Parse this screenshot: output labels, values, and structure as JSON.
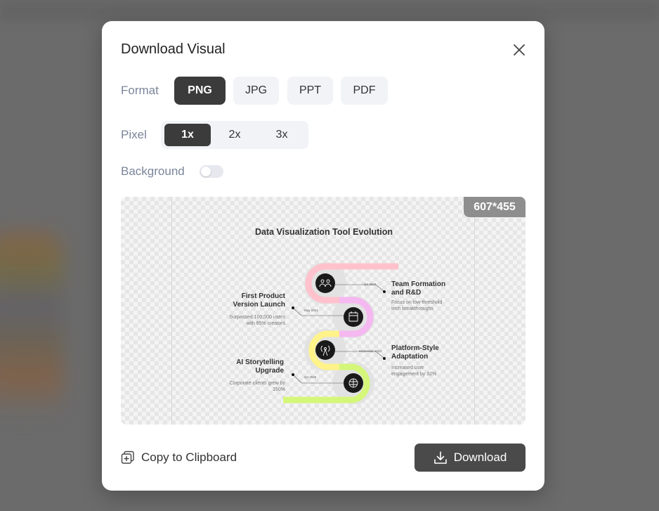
{
  "dialog": {
    "title": "Download Visual",
    "format_label": "Format",
    "formats": [
      "PNG",
      "JPG",
      "PPT",
      "PDF"
    ],
    "selected_format": "PNG",
    "pixel_label": "Pixel",
    "pixels": [
      "1x",
      "2x",
      "3x"
    ],
    "selected_pixel": "1x",
    "background_label": "Background",
    "background_enabled": false,
    "preview_size": "607*455",
    "copy_label": "Copy to Clipboard",
    "download_label": "Download"
  },
  "infographic": {
    "title": "Data Visualization Tool Evolution",
    "milestones": [
      {
        "title_line1": "Team Formation",
        "title_line2": "and R&D",
        "desc_line1": "Focus on low-threshold",
        "desc_line2": "tech breakthroughs",
        "date": "Q3 2023",
        "color": "#ffc2cc",
        "icon": "team-icon"
      },
      {
        "title_line1": "First Product",
        "title_line2": "Version Launch",
        "desc_line1": "Surpassed 100,000 users",
        "desc_line2": "with 85% creators",
        "date": "May 2024",
        "color": "#f5b8f0",
        "icon": "calendar-icon"
      },
      {
        "title_line1": "Platform-Style",
        "title_line2": "Adaptation",
        "desc_line1": "Increased user",
        "desc_line2": "engagement by 32%",
        "date": "December 2024",
        "color": "#fff38a",
        "icon": "broadcast-icon"
      },
      {
        "title_line1": "AI Storytelling",
        "title_line2": "Upgrade",
        "desc_line1": "Corporate clients grew by",
        "desc_line2": "150%",
        "date": "Q3 2025",
        "color": "#d4f77a",
        "icon": "brain-icon"
      }
    ]
  },
  "colors": {
    "active_button": "#3b3b3b",
    "inactive_button": "#f1f3f7",
    "badge": "#8e8e8e"
  }
}
